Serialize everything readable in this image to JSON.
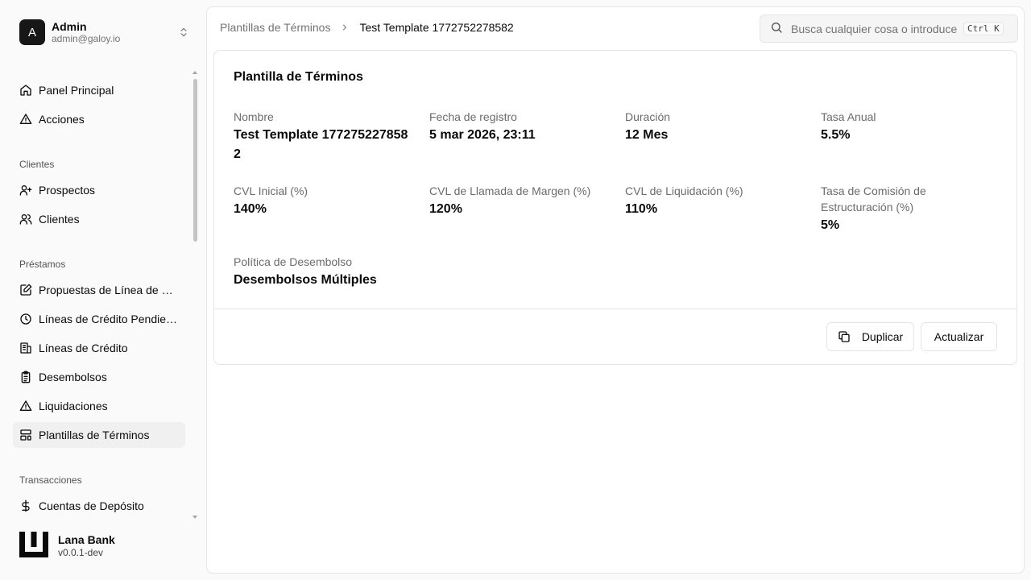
{
  "user": {
    "initial": "A",
    "name": "Admin",
    "email": "admin@galoy.io"
  },
  "nav": {
    "main": [
      {
        "label": "Panel Principal"
      },
      {
        "label": "Acciones"
      }
    ],
    "clientes": {
      "label": "Clientes",
      "items": [
        {
          "label": "Prospectos"
        },
        {
          "label": "Clientes"
        }
      ]
    },
    "prestamos": {
      "label": "Préstamos",
      "items": [
        {
          "label": "Propuestas de Línea de Cr..."
        },
        {
          "label": "Líneas de Crédito Pendient..."
        },
        {
          "label": "Líneas de Crédito"
        },
        {
          "label": "Desembolsos"
        },
        {
          "label": "Liquidaciones"
        },
        {
          "label": "Plantillas de Términos"
        }
      ]
    },
    "transacciones": {
      "label": "Transacciones",
      "items": [
        {
          "label": "Cuentas de Depósito"
        }
      ]
    }
  },
  "brand": {
    "name": "Lana Bank",
    "version": "v0.0.1-dev"
  },
  "breadcrumb": {
    "parent": "Plantillas de Términos",
    "current": "Test Template 1772752278582"
  },
  "search": {
    "placeholder": "Busca cualquier cosa o introduce un",
    "shortcut": "Ctrl K"
  },
  "card": {
    "title": "Plantilla de Términos",
    "fields": [
      {
        "label": "Nombre",
        "value": "Test Template 1772752278582"
      },
      {
        "label": "Fecha de registro",
        "value": "5 mar 2026, 23:11"
      },
      {
        "label": "Duración",
        "value": "12 Mes"
      },
      {
        "label": "Tasa Anual",
        "value": "5.5%"
      },
      {
        "label": "CVL Inicial (%)",
        "value": "140%"
      },
      {
        "label": "CVL de Llamada de Margen (%)",
        "value": "120%"
      },
      {
        "label": "CVL de Liquidación (%)",
        "value": "110%"
      },
      {
        "label": "Tasa de Comisión de Estructuración (%)",
        "value": "5%"
      },
      {
        "label": "Política de Desembolso",
        "value": "Desembolsos Múltiples"
      }
    ],
    "actions": {
      "duplicate": "Duplicar",
      "update": "Actualizar"
    }
  }
}
